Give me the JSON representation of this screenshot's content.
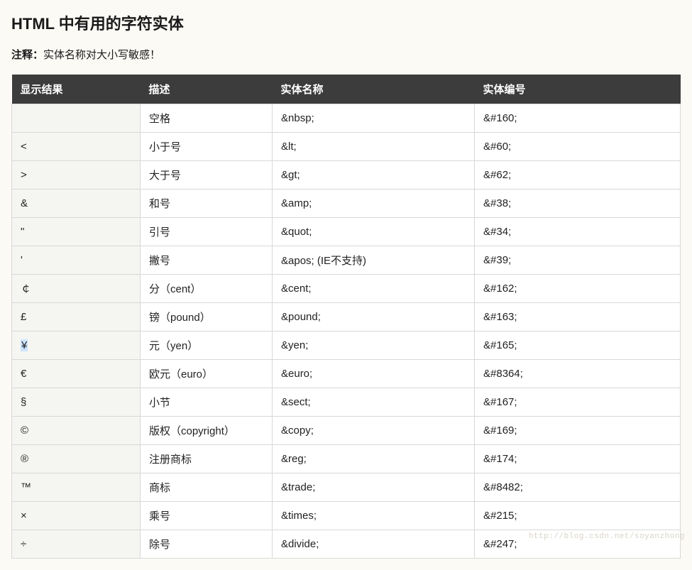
{
  "heading": "HTML 中有用的字符实体",
  "note_label": "注释：",
  "note_text": "实体名称对大小写敏感！",
  "headers": [
    "显示结果",
    "描述",
    "实体名称",
    "实体编号"
  ],
  "rows": [
    {
      "display": " ",
      "desc": "空格",
      "name": "&nbsp;",
      "number": "&#160;",
      "highlight": false
    },
    {
      "display": "<",
      "desc": "小于号",
      "name": "&lt;",
      "number": "&#60;",
      "highlight": false
    },
    {
      "display": ">",
      "desc": "大于号",
      "name": "&gt;",
      "number": "&#62;",
      "highlight": false
    },
    {
      "display": "&",
      "desc": "和号",
      "name": "&amp;",
      "number": "&#38;",
      "highlight": false
    },
    {
      "display": "\"",
      "desc": "引号",
      "name": "&quot;",
      "number": "&#34;",
      "highlight": false
    },
    {
      "display": "'",
      "desc": "撇号",
      "name": "&apos; (IE不支持)",
      "number": "&#39;",
      "highlight": false
    },
    {
      "display": "￠",
      "desc": "分（cent）",
      "name": "&cent;",
      "number": "&#162;",
      "highlight": false
    },
    {
      "display": "£",
      "desc": "镑（pound）",
      "name": "&pound;",
      "number": "&#163;",
      "highlight": false
    },
    {
      "display": "¥",
      "desc": "元（yen）",
      "name": "&yen;",
      "number": "&#165;",
      "highlight": true
    },
    {
      "display": "€",
      "desc": "欧元（euro）",
      "name": "&euro;",
      "number": "&#8364;",
      "highlight": false
    },
    {
      "display": "§",
      "desc": "小节",
      "name": "&sect;",
      "number": "&#167;",
      "highlight": false
    },
    {
      "display": "©",
      "desc": "版权（copyright）",
      "name": "&copy;",
      "number": "&#169;",
      "highlight": false
    },
    {
      "display": "®",
      "desc": "注册商标",
      "name": "&reg;",
      "number": "&#174;",
      "highlight": false
    },
    {
      "display": "™",
      "desc": "商标",
      "name": "&trade;",
      "number": "&#8482;",
      "highlight": false
    },
    {
      "display": "×",
      "desc": "乘号",
      "name": "&times;",
      "number": "&#215;",
      "highlight": false
    },
    {
      "display": "÷",
      "desc": "除号",
      "name": "&divide;",
      "number": "&#247;",
      "highlight": false
    }
  ],
  "watermark": "http://blog.csdn.net/soyanzhong"
}
